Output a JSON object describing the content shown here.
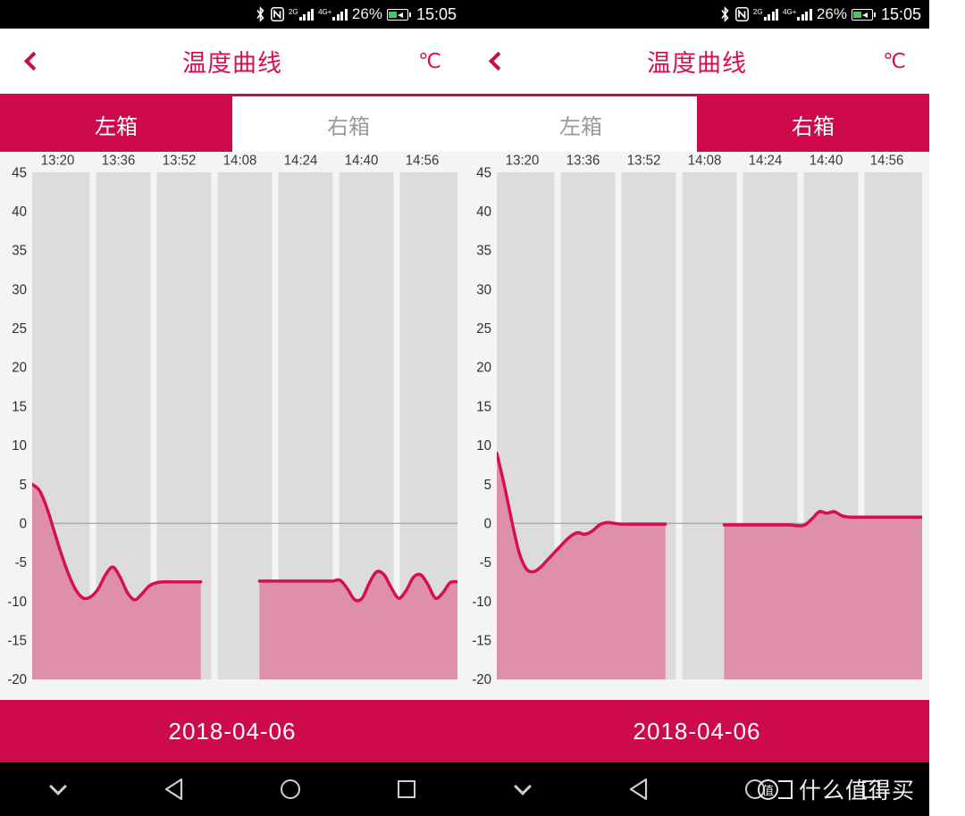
{
  "status_bar": {
    "bluetooth_icon": "bluetooth-icon",
    "nfc_icon": "nfc-icon",
    "sim1_gen": "2G",
    "sim2_gen": "4G+",
    "battery_percent": "26%",
    "battery_icon": "battery-charging-icon",
    "time": "15:05"
  },
  "header": {
    "back_icon": "back-chevron-icon",
    "title": "温度曲线",
    "unit": "℃"
  },
  "tabs": [
    {
      "label": "左箱",
      "active_left": true,
      "active_right": false
    },
    {
      "label": "右箱",
      "active_left": false,
      "active_right": true
    }
  ],
  "date_bar": {
    "date": "2018-04-06"
  },
  "nav_bar": {
    "hide_icon": "chevron-down-icon",
    "back_icon": "back-triangle-icon",
    "home_icon": "home-circle-icon",
    "recents_icon": "recents-square-icon"
  },
  "watermark": {
    "logo": "zhi-badge-logo",
    "text": "什么值得买"
  },
  "colors": {
    "accent": "#cc0a4c",
    "line": "#d6104f",
    "fill": "#dd90a8",
    "band": "#dcdcdc",
    "plot_bg": "#f4f4f4",
    "axis_text": "#3a3a3a"
  },
  "chart_data": [
    {
      "id": "left-chart",
      "panel": "左箱",
      "type": "area",
      "title": "温度曲线",
      "xlabel": "",
      "ylabel": "℃",
      "ylim": [
        -20,
        45
      ],
      "ytick_step": 5,
      "ytick_labels": [
        "45",
        "40",
        "35",
        "30",
        "25",
        "20",
        "15",
        "10",
        "5",
        "0",
        "-5",
        "-10",
        "-15",
        "-20"
      ],
      "xtick_labels": [
        "13:20",
        "13:36",
        "13:52",
        "14:08",
        "14:24",
        "14:40",
        "14:56"
      ],
      "grid": false,
      "zero_line": true,
      "band_count": 7,
      "gap_bands": [
        3
      ],
      "legend": "none",
      "x": [
        0,
        2,
        4,
        6,
        8,
        10,
        12,
        14,
        16,
        18,
        20,
        22,
        24,
        26,
        28,
        30,
        32,
        34,
        36,
        38,
        40,
        42,
        44,
        46,
        48,
        50,
        52,
        54,
        56,
        58,
        60,
        62,
        64,
        66,
        68,
        70,
        72,
        74,
        76,
        78,
        80,
        82,
        84,
        86,
        88,
        90,
        92,
        94,
        96,
        98,
        100
      ],
      "values": [
        5.0,
        4.2,
        2.0,
        -1.0,
        -4.0,
        -6.6,
        -8.6,
        -9.6,
        -9.4,
        -8.4,
        -6.6,
        -5.6,
        -6.9,
        -8.9,
        -9.8,
        -9.0,
        -8.0,
        -7.6,
        -7.5,
        -7.5,
        -7.5,
        -7.5,
        -7.5,
        -7.5,
        null,
        null,
        null,
        null,
        null,
        null,
        null,
        -7.4,
        -7.4,
        -7.4,
        -7.4,
        -7.4,
        -7.4,
        -7.4,
        -7.4,
        -7.4,
        -7.4,
        -7.4,
        -7.3,
        -8.4,
        -9.8,
        -9.6,
        -7.6,
        -6.2,
        -6.6,
        -8.3,
        -9.6,
        -8.6,
        -6.9,
        -6.6,
        -7.9,
        -9.6,
        -8.9,
        -7.6,
        -7.5
      ]
    },
    {
      "id": "right-chart",
      "panel": "右箱",
      "type": "area",
      "title": "温度曲线",
      "xlabel": "",
      "ylabel": "℃",
      "ylim": [
        -20,
        45
      ],
      "ytick_step": 5,
      "ytick_labels": [
        "45",
        "40",
        "35",
        "30",
        "25",
        "20",
        "15",
        "10",
        "5",
        "0",
        "-5",
        "-10",
        "-15",
        "-20"
      ],
      "xtick_labels": [
        "13:20",
        "13:36",
        "13:52",
        "14:08",
        "14:24",
        "14:40",
        "14:56"
      ],
      "grid": false,
      "zero_line": true,
      "band_count": 7,
      "gap_bands": [
        3
      ],
      "legend": "none",
      "values": [
        9.0,
        5.0,
        0.5,
        -3.6,
        -5.8,
        -6.2,
        -5.6,
        -4.6,
        -3.6,
        -2.6,
        -1.7,
        -1.2,
        -1.4,
        -1.0,
        -0.2,
        0.1,
        0.0,
        -0.1,
        -0.1,
        -0.1,
        -0.1,
        -0.1,
        -0.1,
        -0.1,
        null,
        null,
        null,
        null,
        null,
        null,
        null,
        -0.2,
        -0.2,
        -0.2,
        -0.2,
        -0.2,
        -0.2,
        -0.2,
        -0.2,
        -0.2,
        -0.2,
        -0.3,
        -0.2,
        0.6,
        1.5,
        1.3,
        1.5,
        1.0,
        0.8,
        0.8,
        0.8,
        0.8,
        0.8,
        0.8,
        0.8,
        0.8,
        0.8,
        0.8,
        0.8
      ]
    }
  ]
}
